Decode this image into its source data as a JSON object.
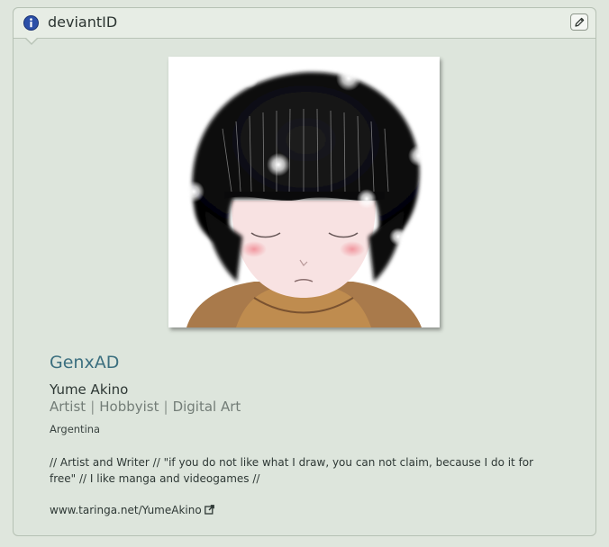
{
  "widget": {
    "title": "deviantID",
    "icons": {
      "info": "info-icon",
      "edit": "pencil-icon"
    }
  },
  "profile": {
    "username": "GenxAD",
    "real_name": "Yume Akino",
    "roles": [
      "Artist",
      "Hobbyist",
      "Digital Art"
    ],
    "country": "Argentina",
    "bio": "// Artist and Writer // \"if you do not like what I draw, you can not claim, because I do it for free\" // I like manga and videogames //",
    "website": "www.taringa.net/YumeAkino",
    "website_icon": "external-link-icon"
  },
  "colors": {
    "username": "#3b6f7f",
    "info_icon": "#2b4fa8",
    "background": "#dde5dc"
  }
}
